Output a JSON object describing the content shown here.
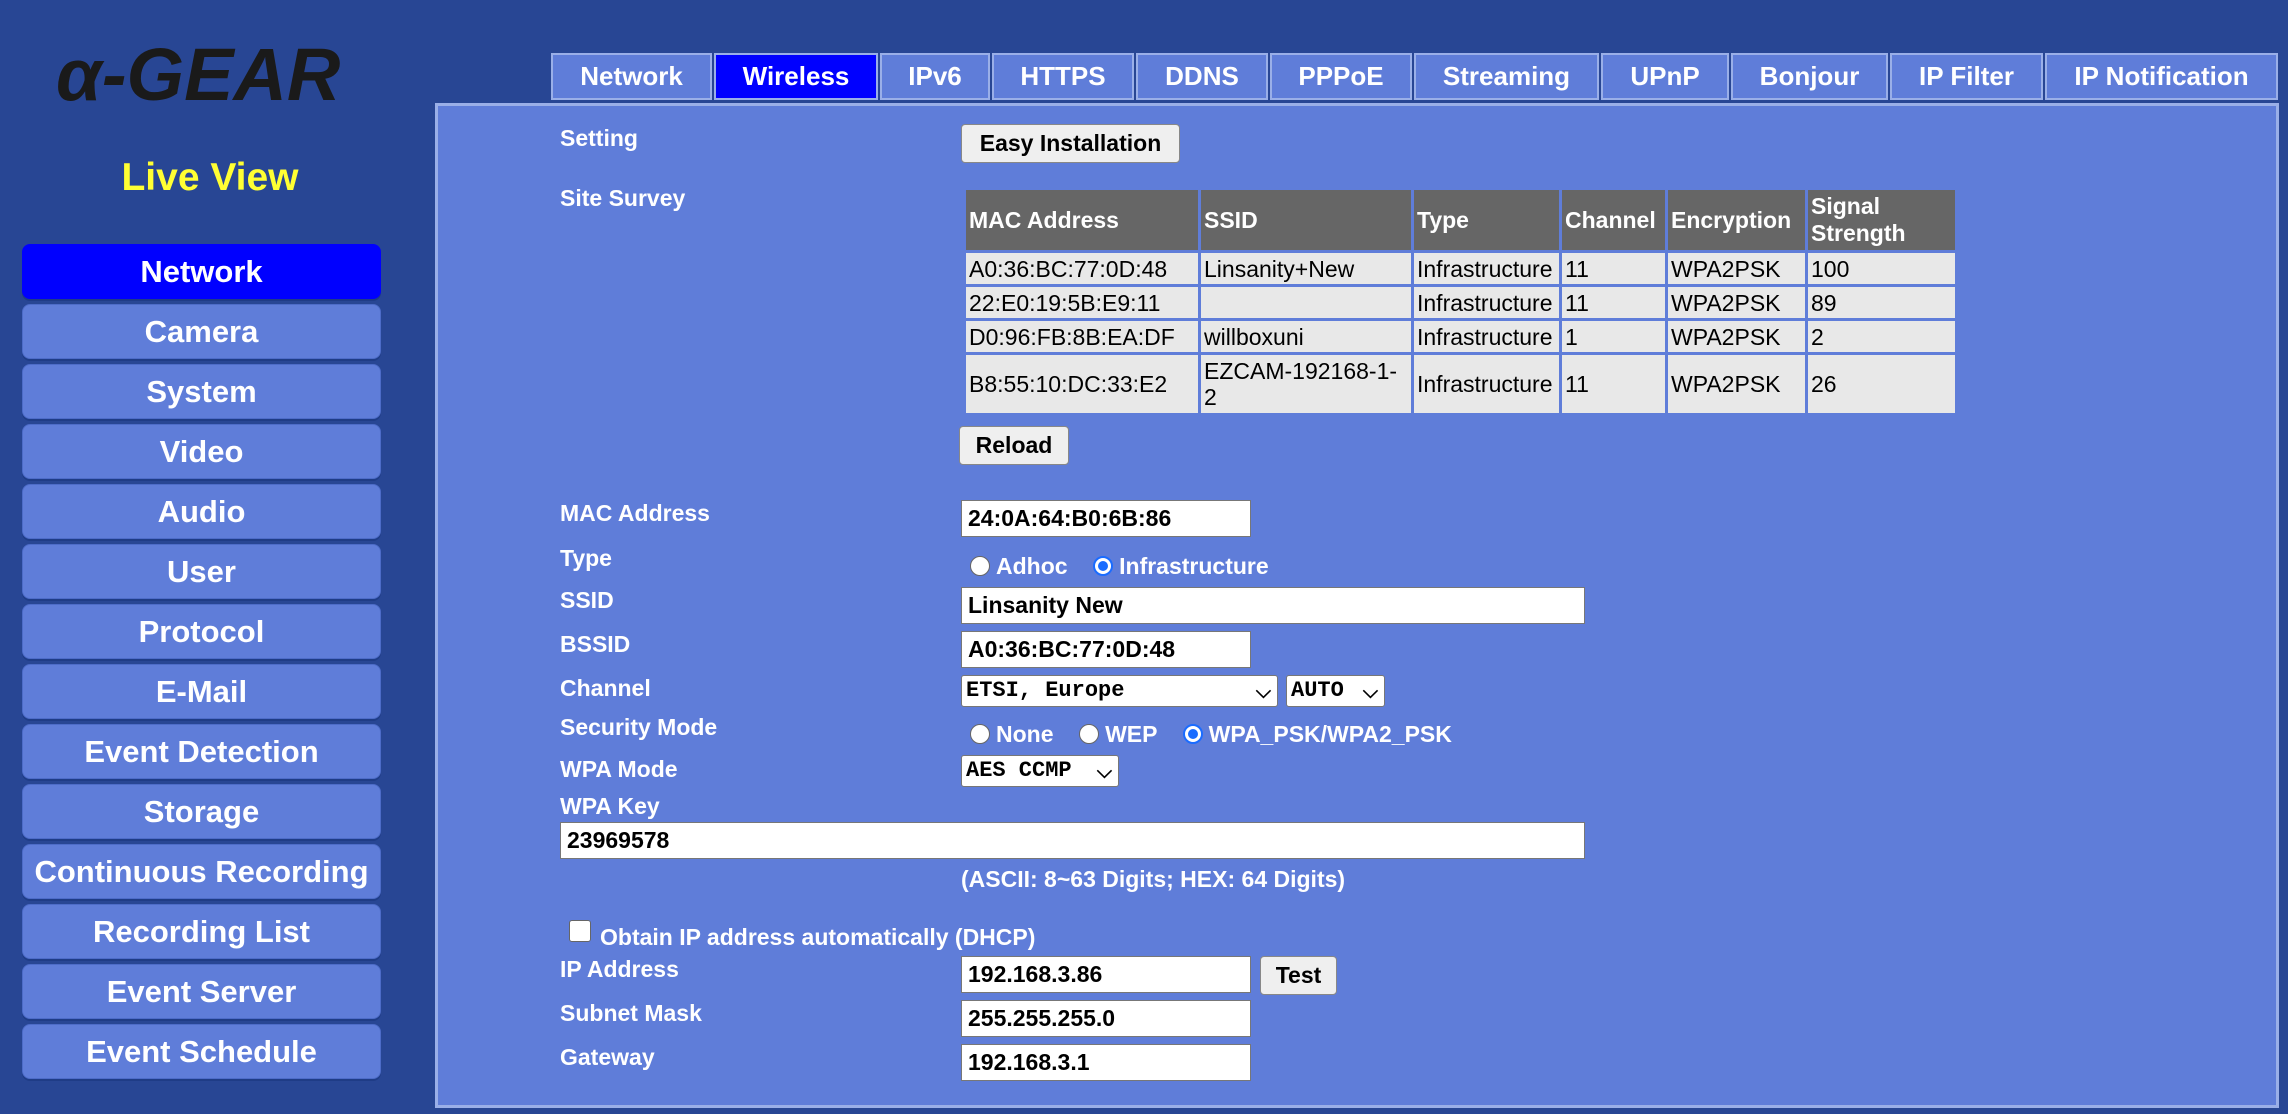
{
  "logo_text": "α-GEAR",
  "live_view": "Live View",
  "sidebar": {
    "items": [
      {
        "label": "Network",
        "active": true
      },
      {
        "label": "Camera"
      },
      {
        "label": "System"
      },
      {
        "label": "Video"
      },
      {
        "label": "Audio"
      },
      {
        "label": "User"
      },
      {
        "label": "Protocol"
      },
      {
        "label": "E-Mail"
      },
      {
        "label": "Event Detection"
      },
      {
        "label": "Storage"
      },
      {
        "label": "Continuous Recording"
      },
      {
        "label": "Recording List"
      },
      {
        "label": "Event Server"
      },
      {
        "label": "Event Schedule"
      }
    ]
  },
  "tabs": [
    {
      "label": "Network"
    },
    {
      "label": "Wireless",
      "active": true
    },
    {
      "label": "IPv6"
    },
    {
      "label": "HTTPS"
    },
    {
      "label": "DDNS"
    },
    {
      "label": "PPPoE"
    },
    {
      "label": "Streaming"
    },
    {
      "label": "UPnP"
    },
    {
      "label": "Bonjour"
    },
    {
      "label": "IP Filter"
    },
    {
      "label": "IP Notification"
    }
  ],
  "form": {
    "setting_label": "Setting",
    "easy_install_button": "Easy Installation",
    "site_survey_label": "Site Survey",
    "survey": {
      "headers": [
        "MAC Address",
        "SSID",
        "Type",
        "Channel",
        "Encryption",
        "Signal Strength"
      ],
      "rows": [
        [
          "A0:36:BC:77:0D:48",
          "Linsanity+New",
          "Infrastructure",
          "11",
          "WPA2PSK",
          "100"
        ],
        [
          "22:E0:19:5B:E9:11",
          "",
          "Infrastructure",
          "11",
          "WPA2PSK",
          "89"
        ],
        [
          "D0:96:FB:8B:EA:DF",
          "willboxuni",
          "Infrastructure",
          "1",
          "WPA2PSK",
          "2"
        ],
        [
          "B8:55:10:DC:33:E2",
          "EZCAM-192168-1-2",
          "Infrastructure",
          "11",
          "WPA2PSK",
          "26"
        ]
      ]
    },
    "reload_button": "Reload",
    "mac_label": "MAC Address",
    "mac_value": "24:0A:64:B0:6B:86",
    "type_label": "Type",
    "type_options": [
      "Adhoc",
      "Infrastructure"
    ],
    "type_selected": "Infrastructure",
    "ssid_label": "SSID",
    "ssid_value": "Linsanity New",
    "bssid_label": "BSSID",
    "bssid_value": "A0:36:BC:77:0D:48",
    "channel_label": "Channel",
    "channel_region": "ETSI, Europe",
    "channel_value": "AUTO",
    "security_label": "Security Mode",
    "security_options": [
      "None",
      "WEP",
      "WPA_PSK/WPA2_PSK"
    ],
    "security_selected": "WPA_PSK/WPA2_PSK",
    "wpa_mode_label": "WPA Mode",
    "wpa_mode_value": "AES CCMP",
    "wpa_key_label": "WPA Key",
    "wpa_key_value": "23969578",
    "wpa_key_hint": "(ASCII: 8~63 Digits; HEX: 64 Digits)",
    "dhcp_label": "Obtain IP address automatically (DHCP)",
    "dhcp_checked": false,
    "ip_label": "IP Address",
    "ip_value": "192.168.3.86",
    "test_button": "Test",
    "subnet_label": "Subnet Mask",
    "subnet_value": "255.255.255.0",
    "gateway_label": "Gateway",
    "gateway_value": "192.168.3.1"
  },
  "colors": {
    "background": "#284694",
    "panel": "#5f7dd9",
    "active": "#0000ff",
    "live_view": "#ffff33",
    "table_header": "#666666",
    "table_cell": "#e8e8e8"
  }
}
